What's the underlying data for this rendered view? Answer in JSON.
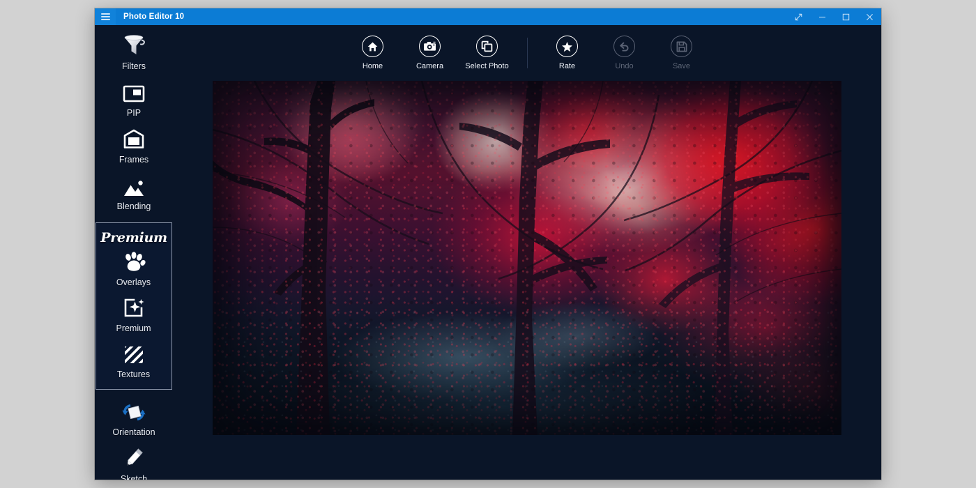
{
  "window": {
    "title": "Photo Editor 10",
    "menu_icon": "hamburger-icon",
    "controls": [
      {
        "name": "restore-expand-button",
        "icon": "diagonal-arrows-icon",
        "label": "Expand"
      },
      {
        "name": "minimize-button",
        "icon": "minimize-icon",
        "label": "Minimize"
      },
      {
        "name": "maximize-button",
        "icon": "maximize-icon",
        "label": "Maximize"
      },
      {
        "name": "close-button",
        "icon": "close-icon",
        "label": "Close"
      }
    ]
  },
  "colors": {
    "titlebar": "#0c7cd5",
    "app_background": "#0a1528",
    "desktop_background": "#d2d2d2",
    "text_primary": "#e8ecf3",
    "text_disabled": "#5d6576",
    "premium_border": "#8d97ab",
    "accent_blue": "#1a6fc4"
  },
  "sidebar": {
    "items_top": [
      {
        "label": "Filters",
        "icon": "funnel-icon"
      },
      {
        "label": "PIP",
        "icon": "picture-in-picture-icon"
      },
      {
        "label": "Frames",
        "icon": "frame-icon"
      },
      {
        "label": "Blending",
        "icon": "mountain-image-icon"
      }
    ],
    "premium_section": {
      "title": "Premium",
      "items": [
        {
          "label": "Overlays",
          "icon": "paw-print-icon"
        },
        {
          "label": "Premium",
          "icon": "sparkle-frame-icon"
        },
        {
          "label": "Textures",
          "icon": "diagonal-stripes-icon"
        }
      ]
    },
    "items_bottom": [
      {
        "label": "Orientation",
        "icon": "rotate-square-icon"
      },
      {
        "label": "Sketch",
        "icon": "pencil-icon"
      }
    ]
  },
  "toolbar": {
    "left_group": [
      {
        "label": "Home",
        "icon": "home-icon",
        "enabled": true
      },
      {
        "label": "Camera",
        "icon": "camera-icon",
        "enabled": true
      },
      {
        "label": "Select Photo",
        "icon": "select-photo-icon",
        "enabled": true
      }
    ],
    "right_group": [
      {
        "label": "Rate",
        "icon": "star-icon",
        "enabled": true
      },
      {
        "label": "Undo",
        "icon": "undo-arrow-icon",
        "enabled": false
      },
      {
        "label": "Save",
        "icon": "floppy-disk-icon",
        "enabled": false
      }
    ]
  },
  "canvas": {
    "photo_description": "Dark misty forest with vivid red and magenta autumn foliage, bare tree trunks and a pale glowing sky through the canopy"
  }
}
